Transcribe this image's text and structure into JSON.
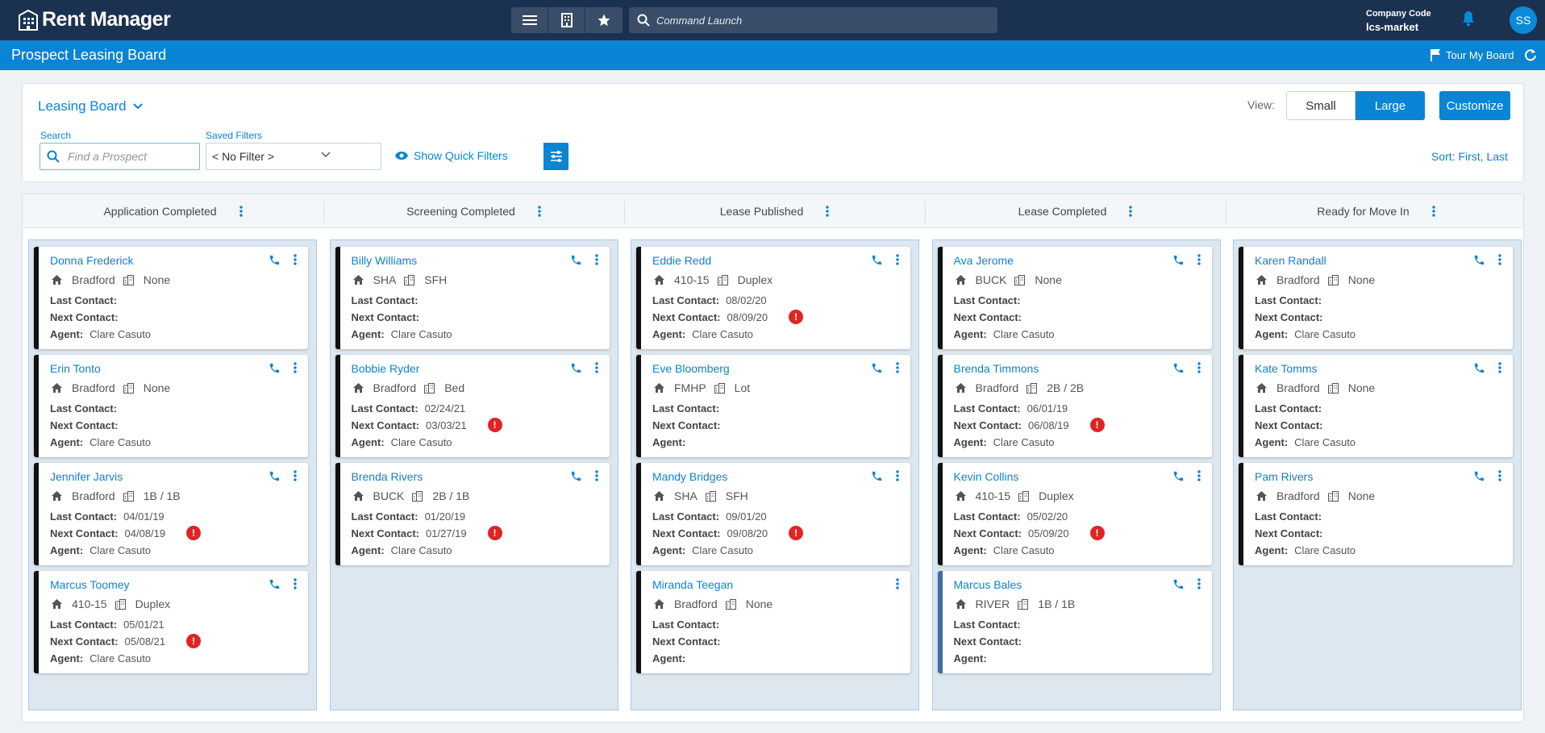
{
  "app": {
    "name": "Rent Manager",
    "command_placeholder": "Command Launch"
  },
  "company": {
    "label": "Company Code",
    "value": "lcs-market"
  },
  "user": {
    "initials": "SS"
  },
  "page": {
    "title": "Prospect Leasing Board",
    "tour_label": "Tour My Board"
  },
  "filters": {
    "board_name": "Leasing Board",
    "search_label": "Search",
    "search_placeholder": "Find a Prospect",
    "saved_label": "Saved Filters",
    "saved_value": "< No Filter >",
    "quick_filters": "Show Quick Filters",
    "view_label": "View:",
    "view_small": "Small",
    "view_large": "Large",
    "customize": "Customize",
    "sort": "Sort: First, Last"
  },
  "labels": {
    "last": "Last Contact:",
    "next": "Next Contact:",
    "agent": "Agent:"
  },
  "columns": [
    {
      "title": "Application Completed",
      "cards": [
        {
          "name": "Donna Frederick",
          "property": "Bradford",
          "unit": "None",
          "last": "",
          "next": "",
          "agent": "Clare Casuto",
          "alert": false
        },
        {
          "name": "Erin Tonto",
          "property": "Bradford",
          "unit": "None",
          "last": "",
          "next": "",
          "agent": "Clare Casuto",
          "alert": false
        },
        {
          "name": "Jennifer Jarvis",
          "property": "Bradford",
          "unit": "1B / 1B",
          "last": "04/01/19",
          "next": "04/08/19",
          "agent": "Clare Casuto",
          "alert": true
        },
        {
          "name": "Marcus Toomey",
          "property": "410-15",
          "unit": "Duplex",
          "last": "05/01/21",
          "next": "05/08/21",
          "agent": "Clare Casuto",
          "alert": true
        }
      ]
    },
    {
      "title": "Screening Completed",
      "cards": [
        {
          "name": "Billy Williams",
          "property": "SHA",
          "unit": "SFH",
          "last": "",
          "next": "",
          "agent": "Clare Casuto",
          "alert": false
        },
        {
          "name": "Bobbie Ryder",
          "property": "Bradford",
          "unit": "Bed",
          "last": "02/24/21",
          "next": "03/03/21",
          "agent": "Clare Casuto",
          "alert": true
        },
        {
          "name": "Brenda Rivers",
          "property": "BUCK",
          "unit": "2B / 1B",
          "last": "01/20/19",
          "next": "01/27/19",
          "agent": "Clare Casuto",
          "alert": true
        }
      ]
    },
    {
      "title": "Lease Published",
      "cards": [
        {
          "name": "Eddie Redd",
          "property": "410-15",
          "unit": "Duplex",
          "last": "08/02/20",
          "next": "08/09/20",
          "agent": "Clare Casuto",
          "alert": true
        },
        {
          "name": "Eve Bloomberg",
          "property": "FMHP",
          "unit": "Lot",
          "last": "",
          "next": "",
          "agent": "",
          "alert": false
        },
        {
          "name": "Mandy Bridges",
          "property": "SHA",
          "unit": "SFH",
          "last": "09/01/20",
          "next": "09/08/20",
          "agent": "Clare Casuto",
          "alert": true
        },
        {
          "name": "Miranda Teegan",
          "property": "Bradford",
          "unit": "None",
          "last": "",
          "next": "",
          "agent": "",
          "alert": false,
          "no_phone": true
        }
      ]
    },
    {
      "title": "Lease Completed",
      "cards": [
        {
          "name": "Ava Jerome",
          "property": "BUCK",
          "unit": "None",
          "last": "",
          "next": "",
          "agent": "Clare Casuto",
          "alert": false
        },
        {
          "name": "Brenda Timmons",
          "property": "Bradford",
          "unit": "2B / 2B",
          "last": "06/01/19",
          "next": "06/08/19",
          "agent": "Clare Casuto",
          "alert": true
        },
        {
          "name": "Kevin Collins",
          "property": "410-15",
          "unit": "Duplex",
          "last": "05/02/20",
          "next": "05/09/20",
          "agent": "Clare Casuto",
          "alert": true
        },
        {
          "name": "Marcus Bales",
          "property": "RIVER",
          "unit": "1B / 1B",
          "last": "",
          "next": "",
          "agent": "",
          "alert": false,
          "accent": "blue"
        }
      ]
    },
    {
      "title": "Ready for Move In",
      "cards": [
        {
          "name": "Karen Randall",
          "property": "Bradford",
          "unit": "None",
          "last": "",
          "next": "",
          "agent": "Clare Casuto",
          "alert": false
        },
        {
          "name": "Kate Tomms",
          "property": "Bradford",
          "unit": "None",
          "last": "",
          "next": "",
          "agent": "Clare Casuto",
          "alert": false
        },
        {
          "name": "Pam Rivers",
          "property": "Bradford",
          "unit": "None",
          "last": "",
          "next": "",
          "agent": "Clare Casuto",
          "alert": false
        }
      ]
    }
  ]
}
